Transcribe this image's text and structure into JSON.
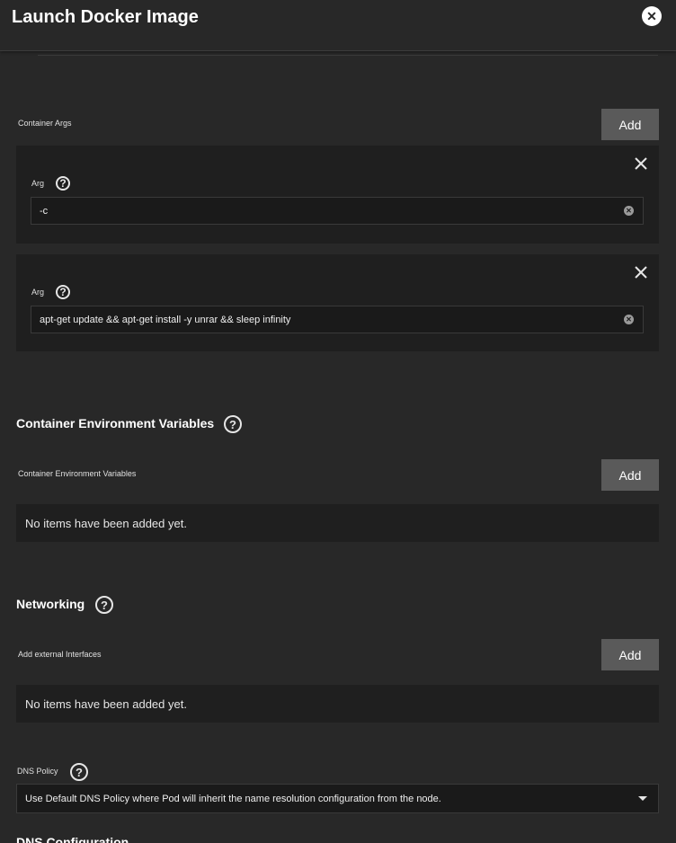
{
  "dialog": {
    "title": "Launch Docker Image",
    "close_icon": "close-circle-icon"
  },
  "container_args": {
    "label": "Container Args",
    "add_label": "Add",
    "items": [
      {
        "label": "Arg",
        "value": "-c"
      },
      {
        "label": "Arg",
        "value": "apt-get update && apt-get install -y unrar && sleep infinity"
      }
    ]
  },
  "env_vars": {
    "section_title": "Container Environment Variables",
    "label": "Container Environment Variables",
    "add_label": "Add",
    "empty_text": "No items have been added yet."
  },
  "networking": {
    "section_title": "Networking",
    "label": "Add external Interfaces",
    "add_label": "Add",
    "empty_text": "No items have been added yet."
  },
  "dns_policy": {
    "label": "DNS Policy",
    "selected": "Use Default DNS Policy where Pod will inherit the name resolution configuration from the node."
  },
  "dns_configuration": {
    "label": "DNS Configuration"
  }
}
